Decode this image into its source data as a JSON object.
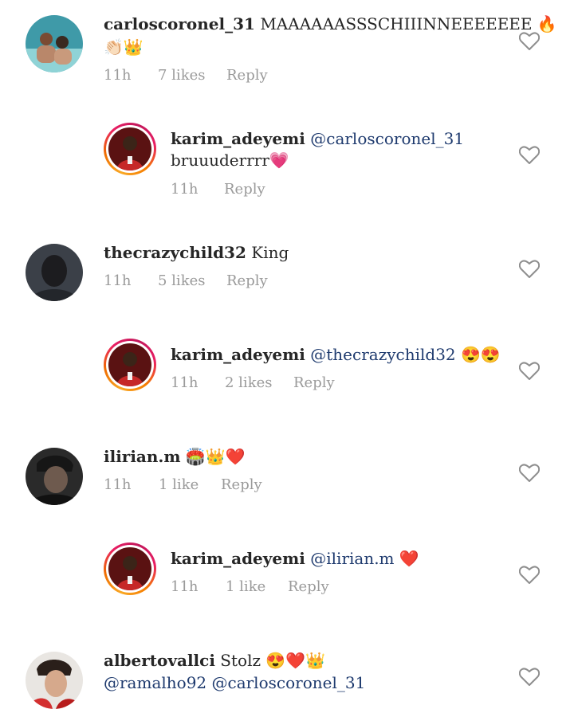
{
  "comments": [
    {
      "username": "carloscoronel_31",
      "text": "MAAAAAASSSCHIIINNEEEEEEE",
      "emoji_line1": "🔥",
      "emoji_line2": "👏🏻👑",
      "time": "11h",
      "likes": "7 likes",
      "reply": "Reply"
    },
    {
      "username": "karim_adeyemi",
      "mention": "@carloscoronel_31",
      "text": "bruuuderrrr",
      "emoji": "💗",
      "time": "11h",
      "reply": "Reply"
    },
    {
      "username": "thecrazychild32",
      "text": "King",
      "time": "11h",
      "likes": "5 likes",
      "reply": "Reply"
    },
    {
      "username": "karim_adeyemi",
      "mention": "@thecrazychild32",
      "emoji": "😍😍",
      "time": "11h",
      "likes": "2 likes",
      "reply": "Reply"
    },
    {
      "username": "ilirian.m",
      "emoji": "🏟️👑❤️",
      "time": "11h",
      "likes": "1 like",
      "reply": "Reply"
    },
    {
      "username": "karim_adeyemi",
      "mention": "@ilirian.m",
      "emoji": "❤️",
      "time": "11h",
      "likes": "1 like",
      "reply": "Reply"
    },
    {
      "username": "albertovallci",
      "text": "Stolz",
      "emoji": "😍❤️👑",
      "mention1": "@ramalho92",
      "mention2": "@carloscoronel_31"
    }
  ],
  "icons": {
    "like": "heart-outline-icon"
  },
  "colors": {
    "text": "#262626",
    "meta": "#9a9a9a",
    "mention": "#1e3a6e",
    "story_ring": "#e91e63"
  }
}
